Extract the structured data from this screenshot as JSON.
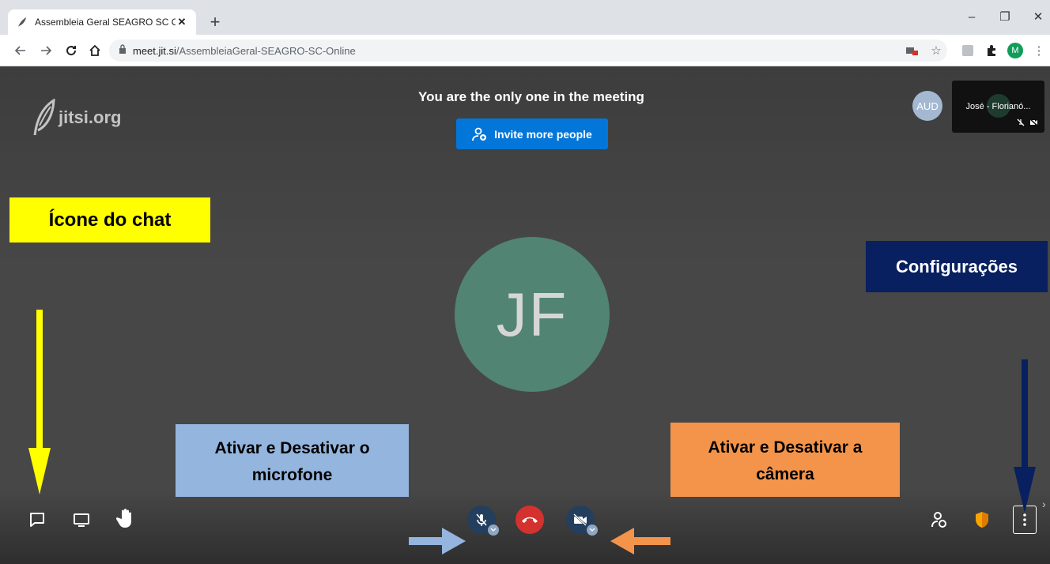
{
  "browser": {
    "tab_title": "Assembleia Geral SEAGRO SC Online",
    "tab_close": "✕",
    "new_tab": "+",
    "url_host": "meet.jit.si",
    "url_path": "/AssembleiaGeral-SEAGRO-SC-Online",
    "profile_initial": "M",
    "win_min": "–",
    "win_restore": "❐",
    "win_close": "✕"
  },
  "meeting": {
    "logo_text": "jitsi.org",
    "status_message": "You are the only one in the meeting",
    "invite_label": "Invite more people",
    "main_avatar_initials": "JF",
    "aud_avatar": "AUD",
    "thumbnail_name": "José - Florianó..."
  },
  "annotations": {
    "chat": "Ícone do chat",
    "settings": "Configurações",
    "mic_line1": "Ativar e Desativar o",
    "mic_line2": "microfone",
    "cam_line1": "Ativar e Desativar a",
    "cam_line2": "câmera"
  },
  "colors": {
    "stage_bg": "#474747",
    "invite_blue": "#0376da",
    "avatar_green": "#528473",
    "hangup_red": "#d3322e",
    "chat_label_bg": "#ffff00",
    "settings_label_bg": "#082060",
    "mic_label_bg": "#94b5dd",
    "cam_label_bg": "#f4944a"
  }
}
